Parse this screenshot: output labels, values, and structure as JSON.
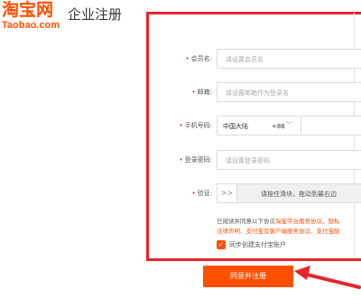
{
  "header": {
    "logo_cn": "淘宝网",
    "logo_en": "Taobao.com",
    "page_title": "企业注册"
  },
  "form": {
    "required_mark": "•",
    "member_name": {
      "label": "会员名:",
      "placeholder": "请设置会员名"
    },
    "email": {
      "label": "邮箱:",
      "placeholder": "请设置邮箱作为登录名"
    },
    "phone": {
      "label": "手机号码:",
      "country": "中国大陆",
      "code": "+86"
    },
    "password": {
      "label": "登录密码:",
      "placeholder": "请设置登录密码"
    },
    "verify": {
      "label": "验证:",
      "handle": ">>",
      "text": "请按住滑块，拖动到最右边"
    }
  },
  "agreement": {
    "line1_prefix": "已阅读并同意以下协议",
    "line1_link": "淘宝平台服务协议、隐私",
    "line2_link": "法律声明、支付宝及客户端服务协议、支付宝隐"
  },
  "alipay_checkbox": {
    "checked": true,
    "label": "同步创建支付宝账户"
  },
  "submit_label": "同意并注册",
  "colors": {
    "accent": "#ff5000",
    "highlight_box": "#e8242d"
  }
}
